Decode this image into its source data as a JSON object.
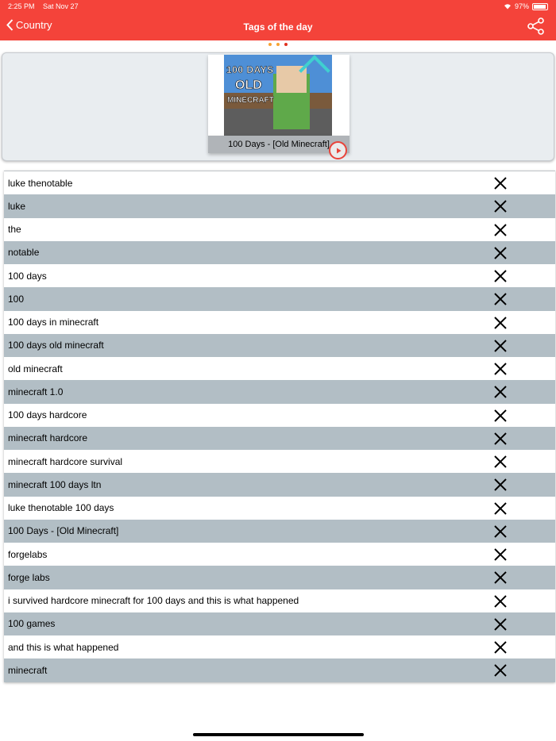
{
  "status_bar": {
    "time": "2:25 PM",
    "date": "Sat Nov 27",
    "battery": "97%"
  },
  "nav": {
    "back_label": "Country",
    "title": "Tags of the day"
  },
  "colors": {
    "accent": "#f4433a",
    "row_alt": "#b2bec5",
    "dot_1": "#f7a233",
    "dot_2": "#f7a233",
    "dot_3": "#e0301e"
  },
  "video": {
    "title": "100 Days - [Old Minecraft]",
    "thumbnail_text": {
      "line1": "100 DAYS",
      "line2": "OLD",
      "line3": "MINECRAFT"
    }
  },
  "tags": [
    "luke thenotable",
    "luke",
    "the",
    "notable",
    "100 days",
    "100",
    "100 days in minecraft",
    "100 days old minecraft",
    "old minecraft",
    "minecraft 1.0",
    "100 days hardcore",
    "minecraft hardcore",
    "minecraft hardcore survival",
    "minecraft 100 days ltn",
    "luke thenotable 100 days",
    "100 Days - [Old Minecraft]",
    "forgelabs",
    "forge labs",
    "i survived hardcore minecraft for 100 days and this is what happened",
    "100 games",
    "and this is what happened",
    "minecraft"
  ]
}
